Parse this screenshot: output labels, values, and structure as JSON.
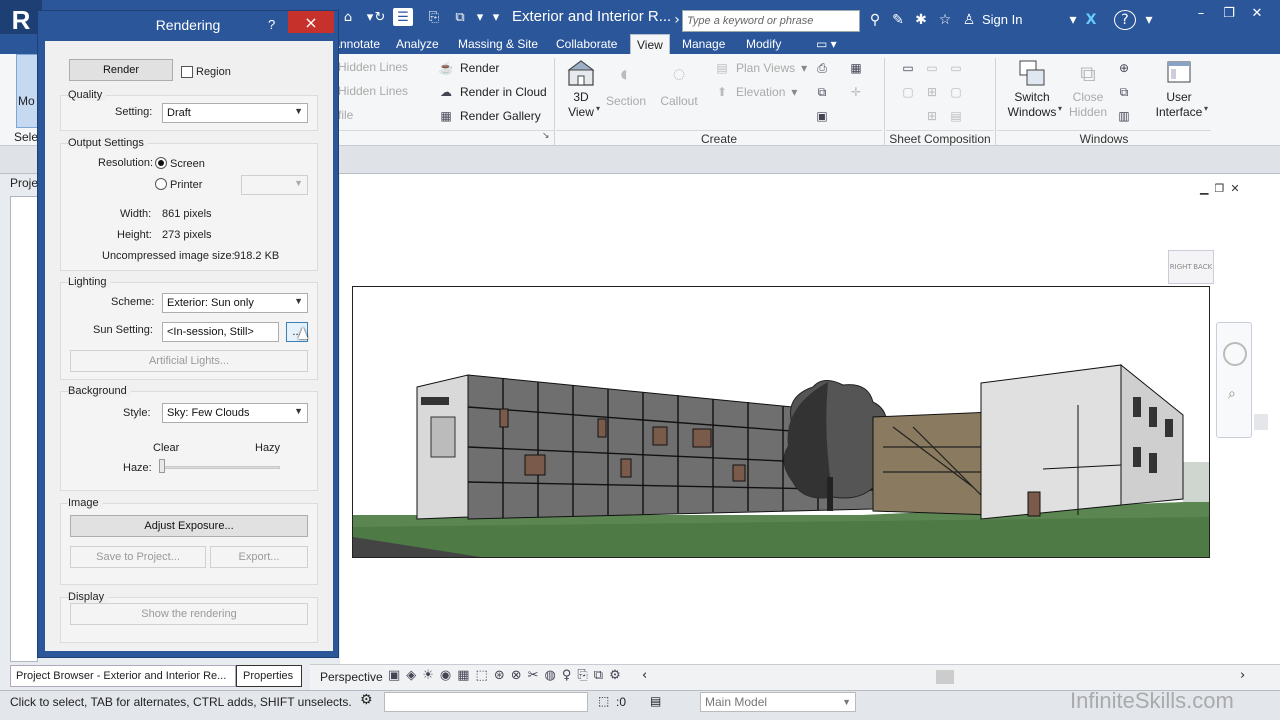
{
  "app": {
    "logo": "R",
    "document_title": "Exterior and Interior R...",
    "search_placeholder": "Type a keyword or phrase",
    "sign_in": "Sign In",
    "help": "?"
  },
  "ribbon_tabs": [
    "Annotate",
    "Analyze",
    "Massing & Site",
    "Collaborate",
    "View",
    "Manage",
    "Modify"
  ],
  "active_tab": "View",
  "ribbon": {
    "graphics": {
      "hidden_lines": "Hidden Lines",
      "remove_hidden_lines": "Hidden Lines",
      "profile": "file",
      "mod_label": "Mo",
      "select_label": "Sele"
    },
    "presentation": {
      "render": "Render",
      "render_in_cloud": "Render  in Cloud",
      "render_gallery": "Render  Gallery"
    },
    "create": {
      "label": "Create",
      "three_d_view_l1": "3D",
      "three_d_view_l2": "View",
      "section": "Section",
      "callout": "Callout",
      "plan_views": "Plan  Views",
      "elevation": "Elevation"
    },
    "sheet_composition": {
      "label": "Sheet Composition"
    },
    "windows": {
      "label": "Windows",
      "switch_windows_l1": "Switch",
      "switch_windows_l2": "Windows",
      "close_hidden_l1": "Close",
      "close_hidden_l2": "Hidden",
      "user_interface_l1": "User",
      "user_interface_l2": "Interface"
    }
  },
  "left_panel": {
    "project_tab": "Proje",
    "project_browser_tab": "Project Browser - Exterior and Interior Re...",
    "properties_tab": "Properties"
  },
  "viewcube": {
    "right": "RIGHT",
    "back": "BACK"
  },
  "view_bar": {
    "view_type": "Perspective"
  },
  "status_bar": {
    "message": "Click to select, TAB for alternates, CTRL adds, SHIFT unselects.",
    "filter_count": ":0",
    "model": "Main Model",
    "watermark": "InfiniteSkills.com"
  },
  "dialog": {
    "title": "Rendering",
    "help": "?",
    "close": "×",
    "render_button": "Render",
    "region_label": "Region",
    "region_checked": false,
    "quality": {
      "group": "Quality",
      "setting_label": "Setting:",
      "setting_value": "Draft"
    },
    "output": {
      "group": "Output Settings",
      "resolution_label": "Resolution:",
      "screen": "Screen",
      "printer": "Printer",
      "selected": "Screen",
      "width_label": "Width:",
      "width_value": "861 pixels",
      "height_label": "Height:",
      "height_value": "273 pixels",
      "size_label": "Uncompressed image size:",
      "size_value": "918.2 KB"
    },
    "lighting": {
      "group": "Lighting",
      "scheme_label": "Scheme:",
      "scheme_value": "Exterior: Sun only",
      "sun_label": "Sun Setting:",
      "sun_value": "<In-session, Still>",
      "sun_browse": "...",
      "artificial": "Artificial Lights..."
    },
    "background": {
      "group": "Background",
      "style_label": "Style:",
      "style_value": "Sky: Few Clouds",
      "clear": "Clear",
      "hazy": "Hazy",
      "haze_label": "Haze:",
      "haze_level": 0
    },
    "image": {
      "group": "Image",
      "adjust": "Adjust Exposure...",
      "save": "Save to Project...",
      "export": "Export..."
    },
    "display": {
      "group": "Display",
      "show": "Show the rendering"
    }
  },
  "colors": {
    "accent": "#2b579a",
    "ribbon": "#f5f6f7",
    "ground": "#4e7a45",
    "building": "#d9d9d9"
  }
}
